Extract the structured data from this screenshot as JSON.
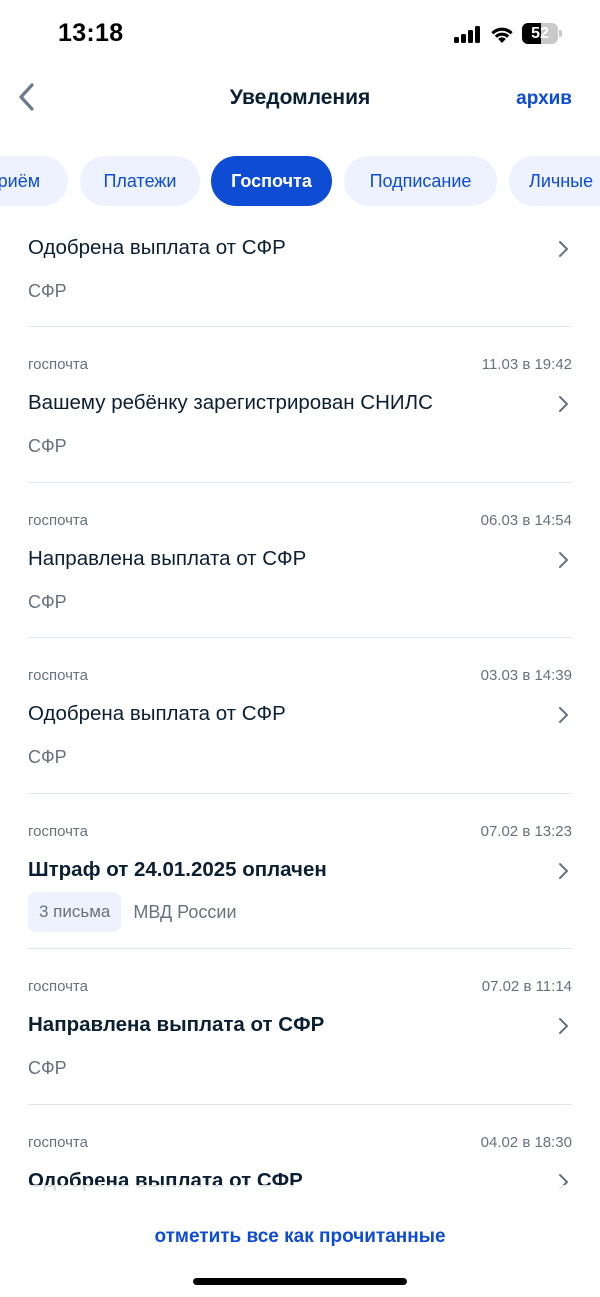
{
  "status_bar": {
    "time": "13:18",
    "battery_level": "52"
  },
  "header": {
    "title": "Уведомления",
    "archive_label": "архив"
  },
  "tabs": [
    {
      "label": "приём",
      "active": false
    },
    {
      "label": "Платежи",
      "active": false
    },
    {
      "label": "Госпочта",
      "active": true
    },
    {
      "label": "Подписание",
      "active": false
    },
    {
      "label": "Личные",
      "active": false
    }
  ],
  "notifications": [
    {
      "source": "",
      "date": "",
      "title": "Одобрена выплата от СФР",
      "sender": "СФР",
      "unread": false
    },
    {
      "source": "госпочта",
      "date": "11.03 в 19:42",
      "title": "Вашему ребёнку зарегистрирован СНИЛС",
      "sender": "СФР",
      "unread": false
    },
    {
      "source": "госпочта",
      "date": "06.03 в 14:54",
      "title": "Направлена выплата от СФР",
      "sender": "СФР",
      "unread": false
    },
    {
      "source": "госпочта",
      "date": "03.03 в 14:39",
      "title": "Одобрена выплата от СФР",
      "sender": "СФР",
      "unread": false
    },
    {
      "source": "госпочта",
      "date": "07.02 в 13:23",
      "title": "Штраф от 24.01.2025 оплачен",
      "badge": "3 письма",
      "sender": "МВД России",
      "unread": true
    },
    {
      "source": "госпочта",
      "date": "07.02 в 11:14",
      "title": "Направлена выплата от СФР",
      "sender": "СФР",
      "unread": true
    },
    {
      "source": "госпочта",
      "date": "04.02 в 18:30",
      "title": "Одобрена выплата от СФР",
      "sender": "",
      "unread": true
    }
  ],
  "footer": {
    "mark_all_label": "отметить все как прочитанные"
  },
  "colors": {
    "accent": "#0d4cd3",
    "tab_background": "#edf2fe",
    "text_primary": "#0b1f33",
    "text_secondary": "#66727f",
    "divider": "#e1e7f2"
  }
}
